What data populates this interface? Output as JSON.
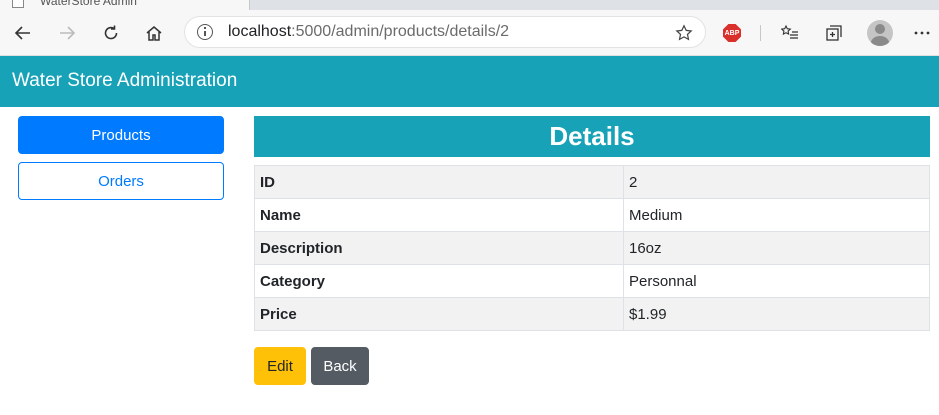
{
  "browser": {
    "tab_title": "WaterStore Admin",
    "url_host": "localhost",
    "url_path": ":5000/admin/products/details/2",
    "abp_label": "ABP"
  },
  "navbar": {
    "brand": "Water Store Administration"
  },
  "sidebar": {
    "products_label": "Products",
    "orders_label": "Orders"
  },
  "main": {
    "heading": "Details",
    "rows": [
      {
        "label": "ID",
        "value": "2"
      },
      {
        "label": "Name",
        "value": "Medium"
      },
      {
        "label": "Description",
        "value": "16oz"
      },
      {
        "label": "Category",
        "value": "Personnal"
      },
      {
        "label": "Price",
        "value": "$1.99"
      }
    ],
    "edit_label": "Edit",
    "back_label": "Back"
  },
  "colors": {
    "navbar": "#17a2b8",
    "primary": "#007bff",
    "warning": "#ffc107",
    "secondary": "#545b62"
  }
}
